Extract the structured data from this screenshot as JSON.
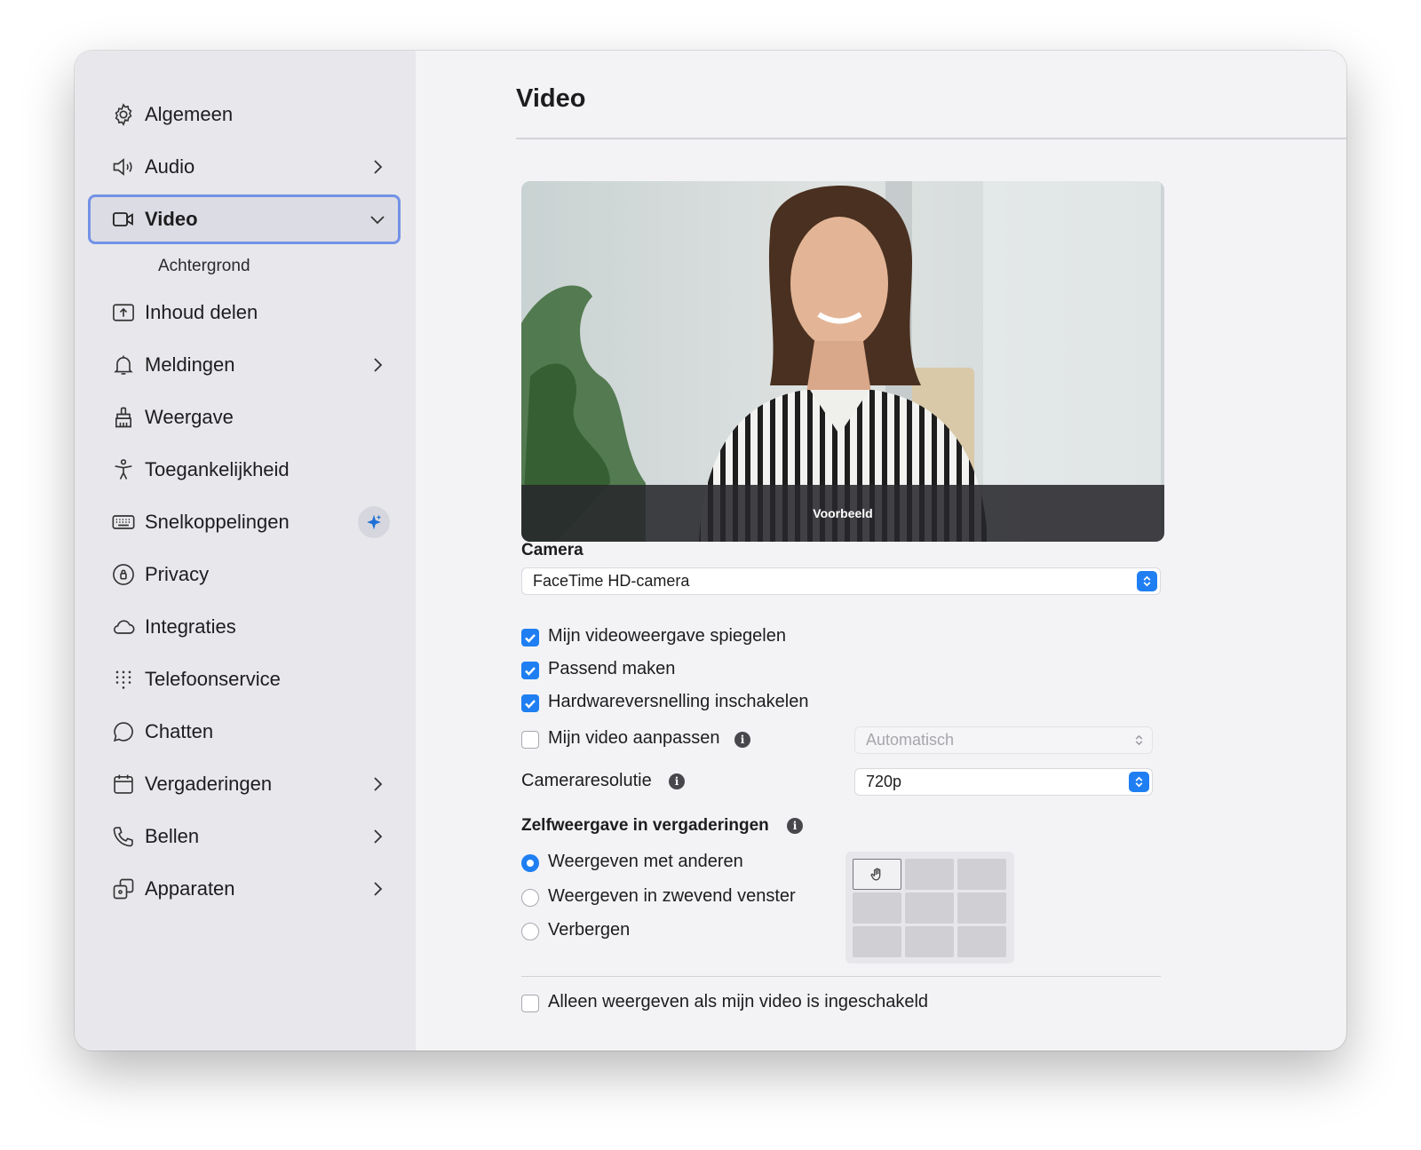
{
  "sidebar": {
    "items": [
      {
        "label": "Algemeen",
        "icon": "gear-icon"
      },
      {
        "label": "Audio",
        "icon": "speaker-icon",
        "chevron": "right"
      },
      {
        "label": "Video",
        "icon": "video-camera-icon",
        "chevron": "down",
        "active": true
      },
      {
        "label": "Inhoud delen",
        "icon": "share-screen-icon"
      },
      {
        "label": "Meldingen",
        "icon": "bell-icon",
        "chevron": "right"
      },
      {
        "label": "Weergave",
        "icon": "brush-icon"
      },
      {
        "label": "Toegankelijkheid",
        "icon": "accessibility-icon"
      },
      {
        "label": "Snelkoppelingen",
        "icon": "keyboard-icon",
        "badge": "sparkle-icon"
      },
      {
        "label": "Privacy",
        "icon": "privacy-icon"
      },
      {
        "label": "Integraties",
        "icon": "cloud-icon"
      },
      {
        "label": "Telefoonservice",
        "icon": "dialpad-icon"
      },
      {
        "label": "Chatten",
        "icon": "chat-bubble-icon"
      },
      {
        "label": "Vergaderingen",
        "icon": "calendar-icon",
        "chevron": "right"
      },
      {
        "label": "Bellen",
        "icon": "phone-icon",
        "chevron": "right"
      },
      {
        "label": "Apparaten",
        "icon": "devices-icon",
        "chevron": "right"
      }
    ],
    "subitem": "Achtergrond"
  },
  "main": {
    "title": "Video",
    "preview_label": "Voorbeeld",
    "camera_label": "Camera",
    "camera_select": "FaceTime HD-camera",
    "checkboxes": [
      {
        "label": "Mijn videoweergave spiegelen",
        "checked": true
      },
      {
        "label": "Passend maken",
        "checked": true
      },
      {
        "label": "Hardwareversnelling inschakelen",
        "checked": true
      },
      {
        "label": "Mijn video aanpassen",
        "checked": false
      }
    ],
    "adjust_select": "Automatisch",
    "resolution_label": "Cameraresolutie",
    "resolution_select": "720p",
    "self_view_label": "Zelfweergave in vergaderingen",
    "radios": [
      {
        "label": "Weergeven met anderen",
        "selected": true
      },
      {
        "label": "Weergeven in zwevend venster",
        "selected": false
      },
      {
        "label": "Verbergen",
        "selected": false
      }
    ],
    "bottom_checkbox": {
      "label": "Alleen weergeven als mijn video is ingeschakeld",
      "checked": false
    }
  },
  "colors": {
    "accent": "#1f7ff2",
    "active_border": "#7392e6",
    "sidebar_bg": "#e8e8ec",
    "main_bg": "#f3f3f6"
  }
}
